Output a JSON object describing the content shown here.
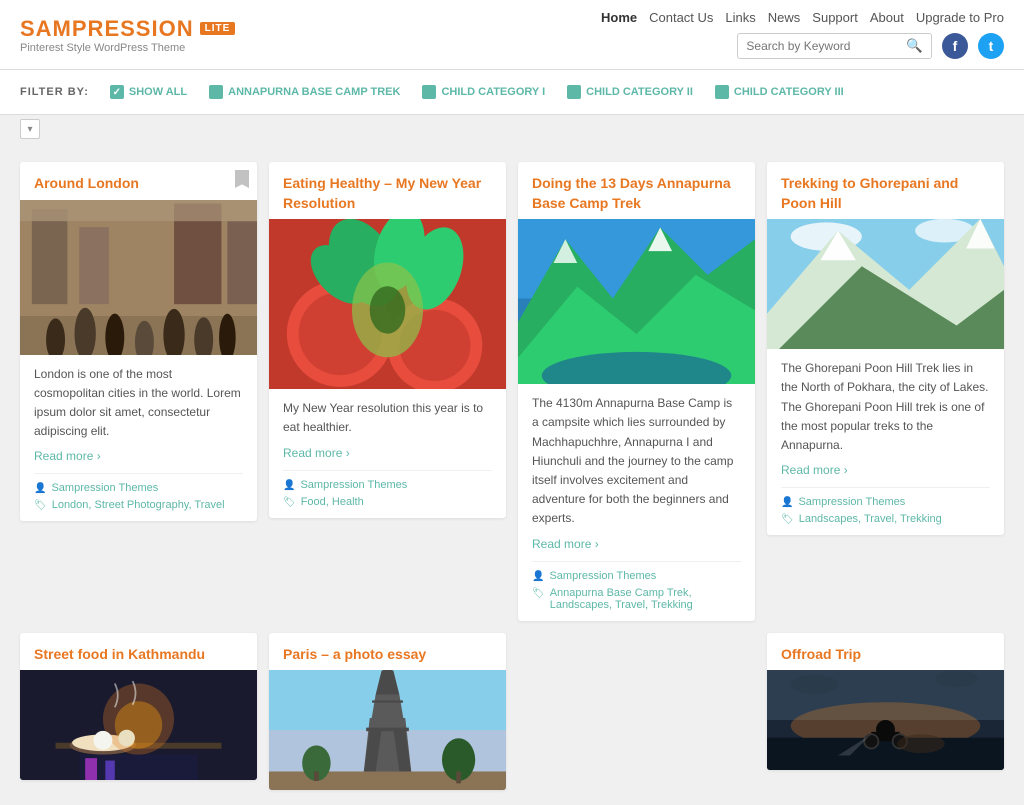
{
  "header": {
    "logo": "SAMPRESSION",
    "logo_lite": "LITE",
    "logo_sub": "Pinterest Style WordPress Theme",
    "nav": [
      {
        "label": "Home",
        "active": true
      },
      {
        "label": "Contact Us",
        "active": false
      },
      {
        "label": "Links",
        "active": false
      },
      {
        "label": "News",
        "active": false
      },
      {
        "label": "Support",
        "active": false
      },
      {
        "label": "About",
        "active": false
      },
      {
        "label": "Upgrade to Pro",
        "active": false
      }
    ],
    "search_placeholder": "Search by Keyword"
  },
  "filter": {
    "label": "FILTER BY:",
    "buttons": [
      {
        "label": "SHOW ALL",
        "checked": true
      },
      {
        "label": "ANNAPURNA BASE CAMP TREK",
        "checked": false
      },
      {
        "label": "CHILD CATEGORY I",
        "checked": false
      },
      {
        "label": "CHILD CATEGORY II",
        "checked": false
      },
      {
        "label": "CHILD CATEGORY III",
        "checked": false
      }
    ]
  },
  "cards": [
    {
      "id": "card1",
      "title": "Around London",
      "image_type": "london",
      "description": "London is one of the most cosmopolitan cities in the world. Lorem ipsum dolor sit amet, consectetur adipiscing elit.",
      "read_more": "Read more ›",
      "author": "Sampression Themes",
      "tags": "London, Street Photography, Travel",
      "has_bookmark": true
    },
    {
      "id": "card2",
      "title": "Eating Healthy – My New Year Resolution",
      "image_type": "food",
      "description": "My New Year resolution this year is to eat healthier.",
      "read_more": "Read more ›",
      "author": "Sampression Themes",
      "tags": "Food, Health",
      "has_bookmark": false
    },
    {
      "id": "card3",
      "title": "Doing the 13 Days Annapurna Base Camp Trek",
      "image_type": "trek",
      "description": "The 4130m Annapurna Base Camp is a campsite which lies surrounded by Machhapuchhre, Annapurna I and Hiunchuli and the journey to the camp itself involves excitement and adventure for both the beginners and experts.",
      "read_more": "Read more ›",
      "author": "Sampression Themes",
      "tags": "Annapurna Base Camp Trek, Landscapes, Travel, Trekking",
      "has_bookmark": false
    },
    {
      "id": "card4",
      "title": "Trekking to Ghorepani and Poon Hill",
      "image_type": "mountain",
      "description": "The Ghorepani Poon Hill Trek lies in the North of Pokhara, the city of Lakes. The Ghorepani Poon Hill trek is one of the most popular treks to the Annapurna.",
      "read_more": "Read more ›",
      "author": "Sampression Themes",
      "tags": "Landscapes, Travel, Trekking",
      "has_bookmark": false
    },
    {
      "id": "card5",
      "title": "Street food in Kathmandu",
      "image_type": "street",
      "description": "",
      "read_more": "",
      "author": "",
      "tags": "",
      "has_bookmark": false
    },
    {
      "id": "card6",
      "title": "Paris – a photo essay",
      "image_type": "paris",
      "description": "",
      "read_more": "",
      "author": "",
      "tags": "",
      "has_bookmark": false
    },
    {
      "id": "card7",
      "title": "",
      "image_type": "none",
      "description": "",
      "read_more": "",
      "author": "",
      "tags": "",
      "has_bookmark": false
    },
    {
      "id": "card8",
      "title": "Offroad Trip",
      "image_type": "offroad",
      "description": "",
      "read_more": "",
      "author": "",
      "tags": "",
      "has_bookmark": false
    }
  ],
  "icons": {
    "search": "🔍",
    "facebook": "f",
    "twitter": "t",
    "user": "👤",
    "tag": "🏷",
    "chevron_down": "▾"
  }
}
